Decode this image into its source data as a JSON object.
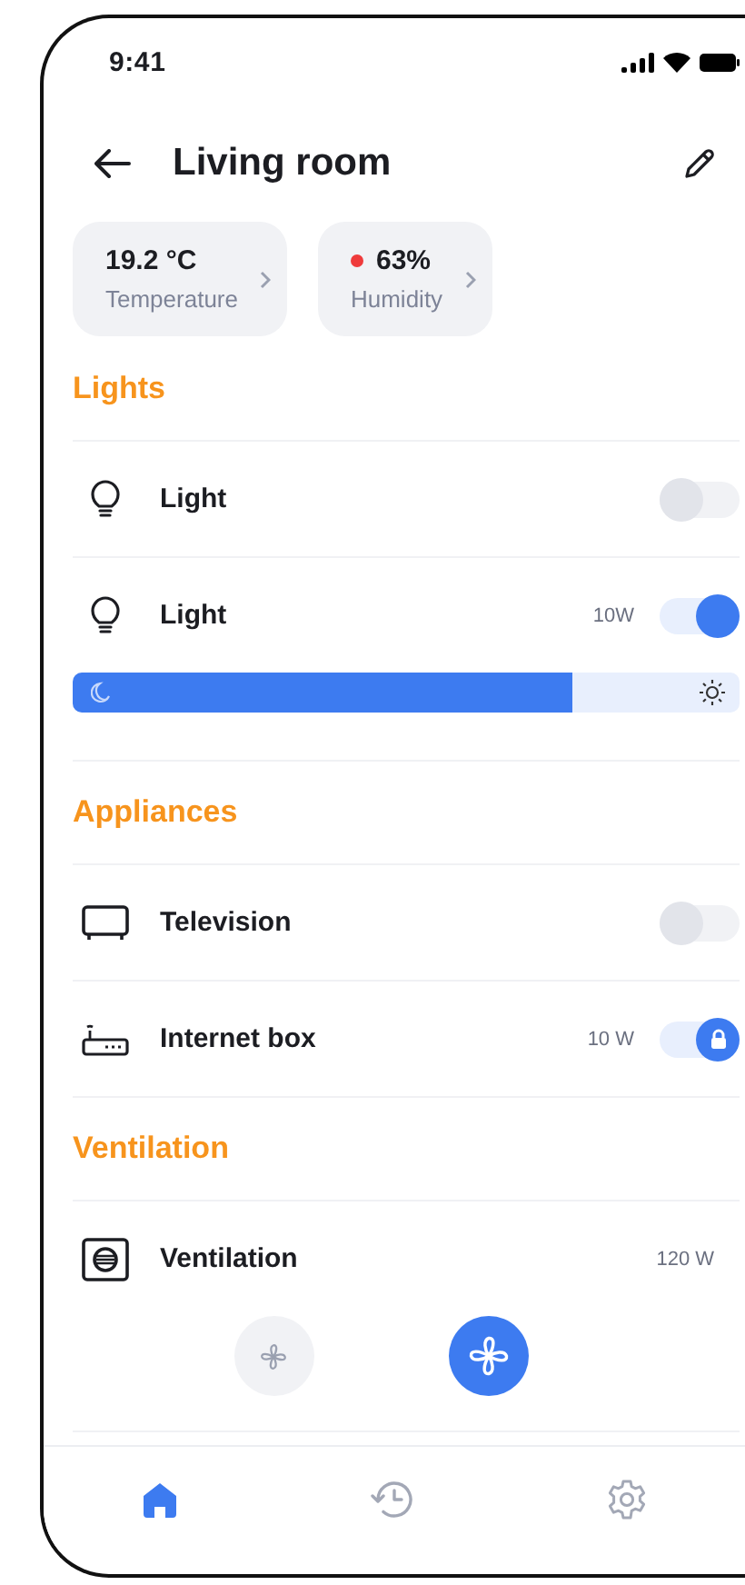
{
  "status_bar": {
    "time": "9:41"
  },
  "header": {
    "title": "Living room"
  },
  "sensors": [
    {
      "value": "19.2 °C",
      "label": "Temperature",
      "alert": false
    },
    {
      "value": "63%",
      "label": "Humidity",
      "alert": true
    }
  ],
  "sections": [
    {
      "title": "Lights",
      "devices": [
        {
          "kind": "light",
          "name": "Light",
          "on": false
        },
        {
          "kind": "dimmer",
          "name": "Light",
          "power": "10W",
          "on": true,
          "level": 0.75
        }
      ]
    },
    {
      "title": "Appliances",
      "devices": [
        {
          "kind": "television",
          "name": "Television",
          "on": false
        },
        {
          "kind": "router",
          "name": "Internet box",
          "power": "10 W",
          "on": true,
          "locked": true
        }
      ]
    },
    {
      "title": "Ventilation",
      "devices": [
        {
          "kind": "ventilation",
          "name": "Ventilation",
          "power": "120 W",
          "fan_modes": [
            {
              "selected": false
            },
            {
              "selected": true
            }
          ]
        }
      ]
    }
  ],
  "tabs": [
    {
      "selected": true
    },
    {
      "selected": false
    },
    {
      "selected": false
    }
  ]
}
